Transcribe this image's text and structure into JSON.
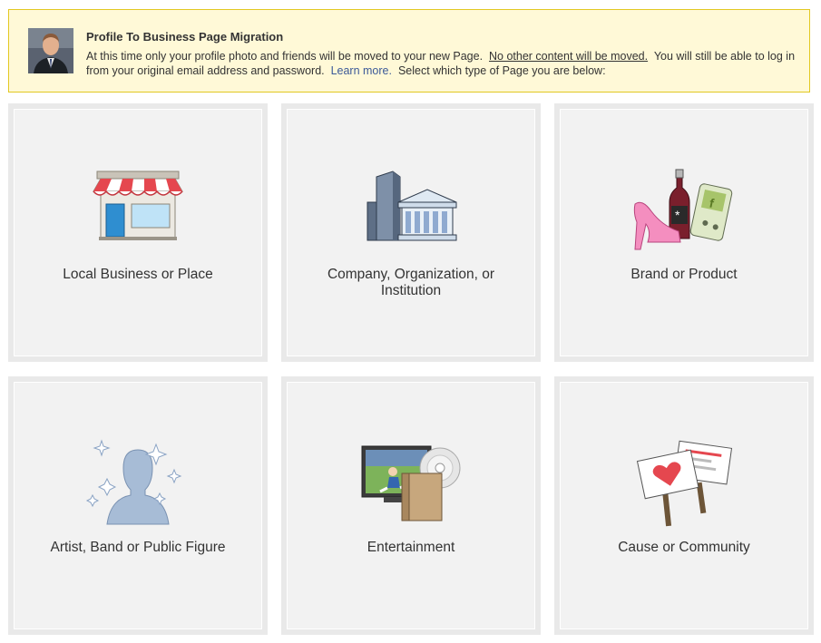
{
  "notice": {
    "title": "Profile To Business Page Migration",
    "text_1": "At this time only your profile photo and friends will be moved to your new Page.",
    "underlined": "No other content will be moved.",
    "text_2": "You will still be able to log in from your original email address and password.",
    "learn_more": "Learn more.",
    "text_3": "Select which type of Page you are below:"
  },
  "categories": [
    {
      "label": "Local Business or Place",
      "icon": "storefront-icon"
    },
    {
      "label": "Company, Organization, or Institution",
      "icon": "buildings-icon"
    },
    {
      "label": "Brand or Product",
      "icon": "products-icon"
    },
    {
      "label": "Artist, Band or Public Figure",
      "icon": "silhouette-icon"
    },
    {
      "label": "Entertainment",
      "icon": "media-icon"
    },
    {
      "label": "Cause or Community",
      "icon": "signs-icon"
    }
  ],
  "colors": {
    "notice_bg": "#fff9d7",
    "notice_border": "#e2c822",
    "link": "#3b5998",
    "tile_bg": "#f2f2f2",
    "tile_border": "#e9e9e9"
  }
}
